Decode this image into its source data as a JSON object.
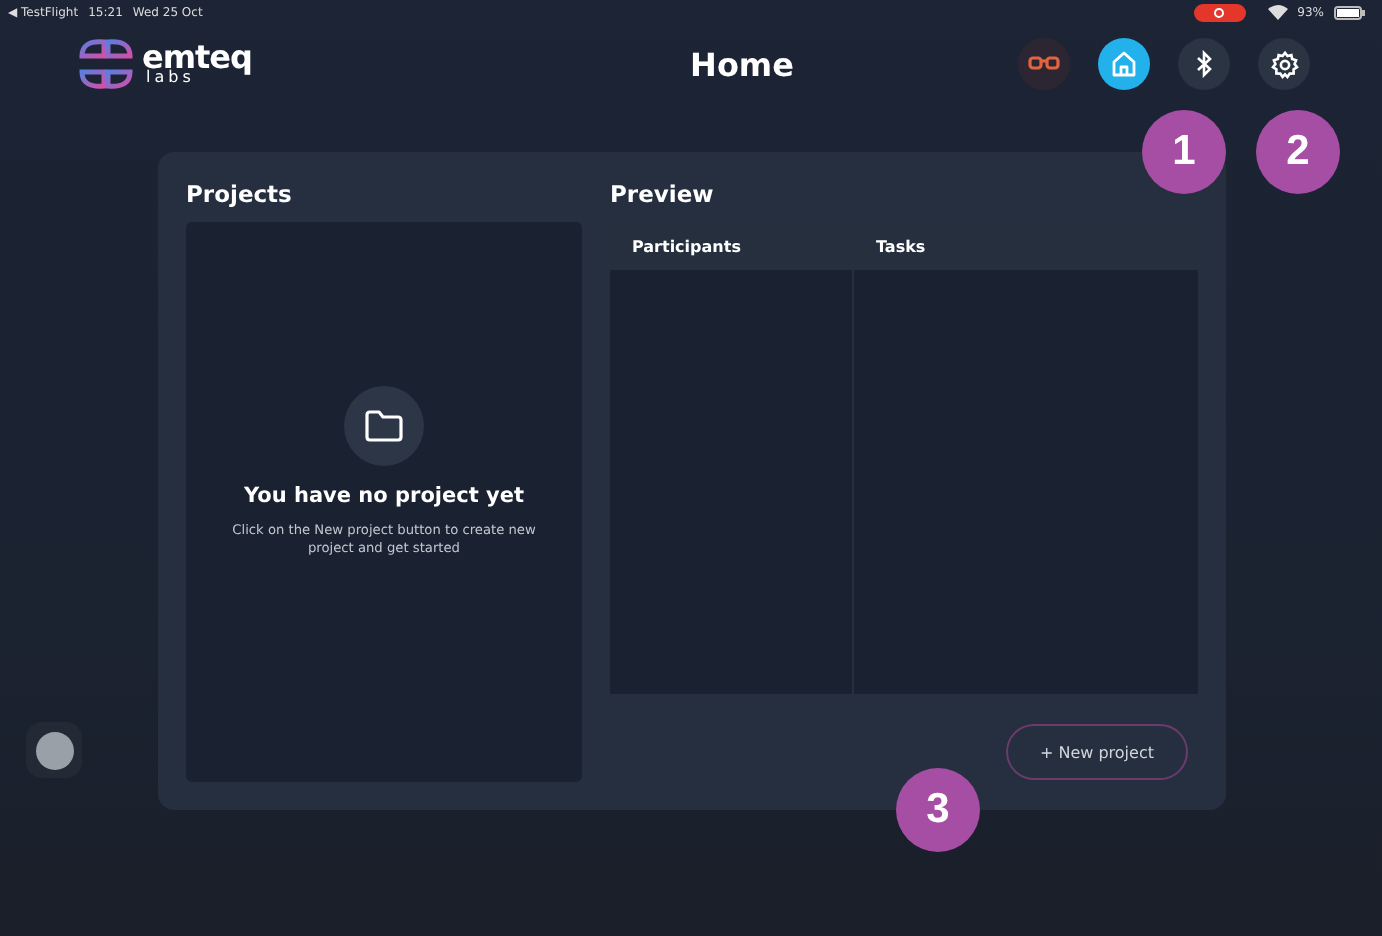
{
  "status_bar": {
    "back": "◀ TestFlight",
    "time": "15:21",
    "date": "Wed 25 Oct",
    "battery": "93%"
  },
  "header": {
    "logo": "emteq",
    "logo_sub": "labs",
    "title": "Home"
  },
  "nav_icons": [
    {
      "kind": "glasses",
      "selected": false
    },
    {
      "kind": "home",
      "selected": true
    },
    {
      "kind": "bluetooth",
      "selected": false
    },
    {
      "kind": "settings",
      "selected": false
    }
  ],
  "projects": {
    "title": "Projects",
    "empty_title": "You have no project yet",
    "empty_text": "Click on the New project button to create new project and get started"
  },
  "preview": {
    "title": "Preview",
    "columns": [
      "Participants",
      "Tasks"
    ]
  },
  "new_project_button": "+ New project",
  "annotations": [
    {
      "label": "1"
    },
    {
      "label": "2"
    },
    {
      "label": "3"
    }
  ]
}
